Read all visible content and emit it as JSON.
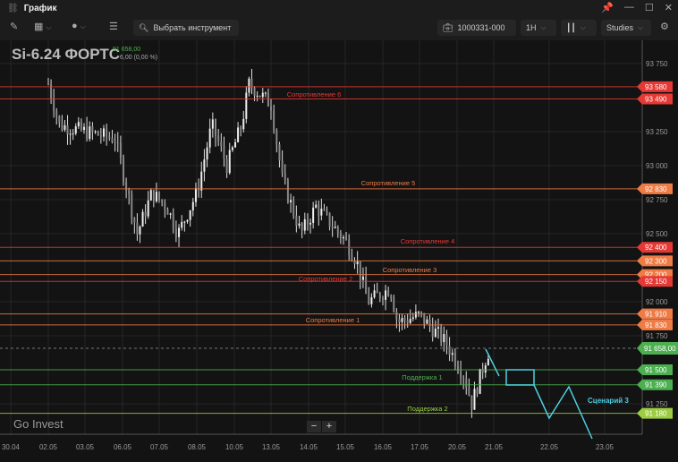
{
  "window": {
    "title": "График"
  },
  "toolbar": {
    "search_placeholder": "Выбрать инструмент",
    "account": "1000331-000",
    "interval": "1H",
    "studies": "Studies"
  },
  "instrument": {
    "symbol": "Si-6.24 ФОРТС",
    "last": "91 658,00",
    "change": "6,00 (0,00 %)"
  },
  "watermark": "Go Invest",
  "zoom": {
    "minus": "−",
    "plus": "+"
  },
  "chart_data": {
    "type": "candlestick",
    "y_ticks": [
      "93 750",
      "93 250",
      "93 000",
      "92 750",
      "92 500",
      "92 000",
      "91 750",
      "91 250"
    ],
    "y_tick_values": [
      93750,
      93250,
      93000,
      92750,
      92500,
      92000,
      91750,
      91250
    ],
    "x_ticks": [
      "30.04",
      "02.05",
      "03.05",
      "06.05",
      "07.05",
      "08.05",
      "10.05",
      "13.05",
      "14.05",
      "15.05",
      "16.05",
      "17.05",
      "20.05",
      "21.05",
      "22.05",
      "23.05"
    ],
    "ylim": [
      91080,
      93960
    ],
    "price_anchors": [
      [
        1,
        93600
      ],
      [
        1.3,
        93300
      ],
      [
        2,
        93250
      ],
      [
        2.8,
        93200
      ],
      [
        3.4,
        92500
      ],
      [
        3.8,
        92800
      ],
      [
        4.2,
        92700
      ],
      [
        4.5,
        92500
      ],
      [
        5,
        92800
      ],
      [
        5.4,
        93300
      ],
      [
        5.8,
        93000
      ],
      [
        6.2,
        93300
      ],
      [
        6.4,
        93600
      ],
      [
        7,
        93450
      ],
      [
        7.3,
        92900
      ],
      [
        7.8,
        92500
      ],
      [
        8.2,
        92700
      ],
      [
        9,
        92450
      ],
      [
        9.3,
        92300
      ],
      [
        9.6,
        92000
      ],
      [
        10.2,
        92100
      ],
      [
        10.4,
        91850
      ],
      [
        11,
        91900
      ],
      [
        11.7,
        91700
      ],
      [
        12.2,
        91450
      ],
      [
        12.4,
        91250
      ],
      [
        12.8,
        91600
      ],
      [
        12.9,
        91658
      ]
    ],
    "levels": [
      {
        "price": 93580,
        "label": "93 580",
        "color": "#e53935",
        "name": ""
      },
      {
        "price": 93490,
        "label": "93 490",
        "color": "#e53935",
        "name": "Сопротивление 6"
      },
      {
        "price": 92830,
        "label": "92 830",
        "color": "#ef7b45",
        "name": "Сопротивление 5"
      },
      {
        "price": 92400,
        "label": "92 400",
        "color": "#e53935",
        "name": "Сопротивление 4"
      },
      {
        "price": 92300,
        "label": "92 300",
        "color": "#ef7b45",
        "name": "Сопротивление 3"
      },
      {
        "price": 92200,
        "label": "92 200",
        "color": "#ef7b45",
        "name": ""
      },
      {
        "price": 92150,
        "label": "92 150",
        "color": "#e53935",
        "name": "Сопротивление 2"
      },
      {
        "price": 91910,
        "label": "91 910",
        "color": "#ef7b45",
        "name": ""
      },
      {
        "price": 91830,
        "label": "91 830",
        "color": "#ef7b45",
        "name": "Сопротивление 1"
      },
      {
        "price": 91500,
        "label": "91 500",
        "color": "#4caf50",
        "name": "Поддержка 1"
      },
      {
        "price": 91390,
        "label": "91 390",
        "color": "#4caf50",
        "name": ""
      },
      {
        "price": 91180,
        "label": "91 180",
        "color": "#9ccc42",
        "name": "Поддержка 2"
      }
    ],
    "current": {
      "price": 91658,
      "label": "91 658,00",
      "color": "#4caf50"
    },
    "scenario": {
      "label": "Сценарий 3",
      "color": "#4dd0e1"
    }
  }
}
